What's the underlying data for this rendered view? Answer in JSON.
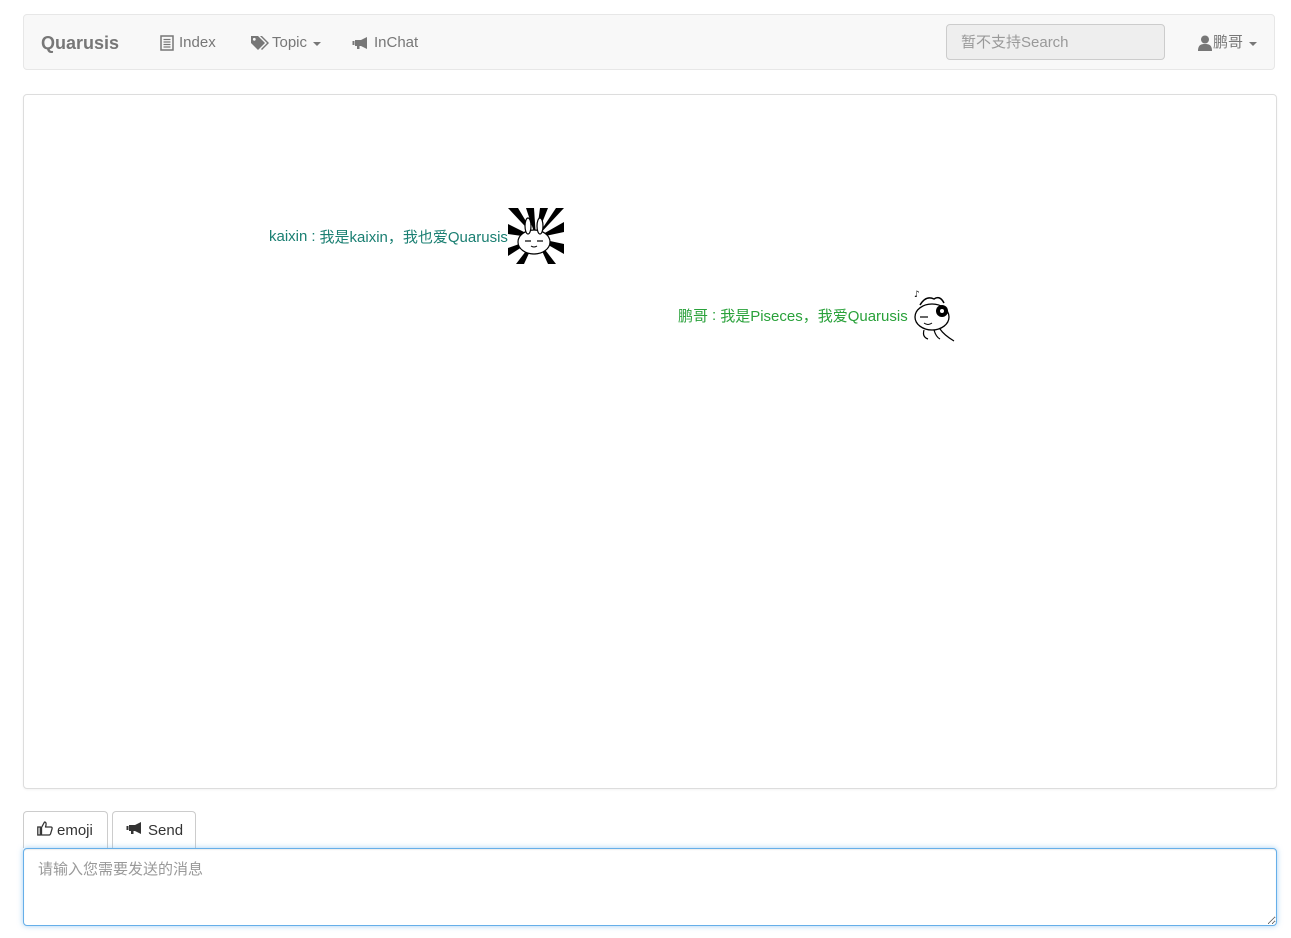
{
  "navbar": {
    "brand": "Quarusis",
    "items": [
      {
        "label": "Index",
        "icon": "list-icon"
      },
      {
        "label": "Topic",
        "icon": "tags-icon",
        "dropdown": true
      },
      {
        "label": "InChat",
        "icon": "bullhorn-icon"
      }
    ],
    "search_placeholder": "暂不支持Search",
    "user": {
      "label": "鹏哥",
      "icon": "user-icon",
      "dropdown": true
    }
  },
  "chat": {
    "messages": [
      {
        "sender": "kaixin",
        "separator": ":",
        "text": "我是kaixin，我也爱Quarusis",
        "color": "#1a7f72",
        "avatar": "rabbit-sunburst-avatar"
      },
      {
        "sender": "鹏哥",
        "separator": ":",
        "text": "我是Piseces，我爱Quarusis",
        "color": "#29a13a",
        "avatar": "rabbit-headphones-avatar"
      }
    ]
  },
  "composer": {
    "emoji_label": "emoji",
    "send_label": "Send",
    "placeholder": "请输入您需要发送的消息"
  }
}
